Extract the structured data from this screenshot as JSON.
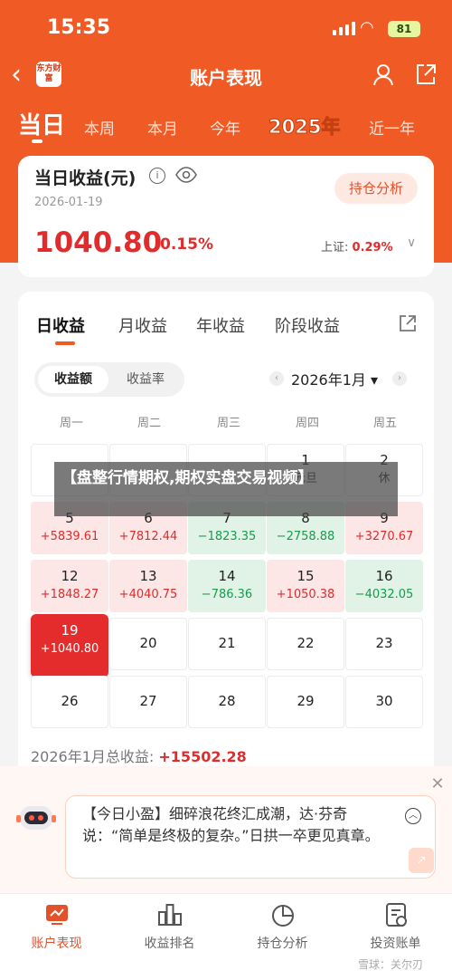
{
  "status": {
    "time": "15:35",
    "battery": "81"
  },
  "nav": {
    "logo_text": "东方财富",
    "title": "账户表现"
  },
  "periods": [
    {
      "label": "当日",
      "active": true
    },
    {
      "label": "本周"
    },
    {
      "label": "本月"
    },
    {
      "label": "今年"
    },
    {
      "label": "2025年"
    },
    {
      "label": "近一年"
    }
  ],
  "daily": {
    "title": "当日收益(元)",
    "date": "2026-01-19",
    "button": "持仓分析",
    "amount": "1040.80",
    "pct": "0.15%",
    "index_label": "上证:",
    "index_value": "0.29%"
  },
  "calendar": {
    "tabs": [
      "日收益",
      "月收益",
      "年收益",
      "阶段收益"
    ],
    "segments": [
      "收益额",
      "收益率"
    ],
    "month": "2026年1月",
    "weekdays": [
      "周一",
      "周二",
      "周三",
      "周四",
      "周五"
    ],
    "holiday_tag": "休",
    "rows": [
      [
        {
          "day": "",
          "value": ""
        },
        {
          "day": "",
          "value": ""
        },
        {
          "day": "",
          "value": ""
        },
        {
          "day": "1",
          "value": "元旦"
        },
        {
          "day": "2",
          "value": "休"
        }
      ],
      [
        {
          "day": "5",
          "value": "+5839.61",
          "trend": "up"
        },
        {
          "day": "6",
          "value": "+7812.44",
          "trend": "up"
        },
        {
          "day": "7",
          "value": "−1823.35",
          "trend": "down"
        },
        {
          "day": "8",
          "value": "−2758.88",
          "trend": "down"
        },
        {
          "day": "9",
          "value": "+3270.67",
          "trend": "up"
        }
      ],
      [
        {
          "day": "12",
          "value": "+1848.27",
          "trend": "up"
        },
        {
          "day": "13",
          "value": "+4040.75",
          "trend": "up"
        },
        {
          "day": "14",
          "value": "−786.36",
          "trend": "down"
        },
        {
          "day": "15",
          "value": "+1050.38",
          "trend": "up"
        },
        {
          "day": "16",
          "value": "−4032.05",
          "trend": "down"
        }
      ],
      [
        {
          "day": "19",
          "value": "+1040.80",
          "trend": "today"
        },
        {
          "day": "20",
          "value": ""
        },
        {
          "day": "21",
          "value": ""
        },
        {
          "day": "22",
          "value": ""
        },
        {
          "day": "23",
          "value": ""
        }
      ],
      [
        {
          "day": "26",
          "value": ""
        },
        {
          "day": "27",
          "value": ""
        },
        {
          "day": "28",
          "value": ""
        },
        {
          "day": "29",
          "value": ""
        },
        {
          "day": "30",
          "value": ""
        }
      ]
    ],
    "total_label": "2026年1月总收益:",
    "total_value": "+15502.28"
  },
  "banner": "【盘整行情期权,期权实盘交易视频】",
  "tip": {
    "text_prefix": "【今日小盈】",
    "text": "细碎浪花终汇成潮，达·芬奇说：“简单是终极的复杂。”日拱一卒更见真章。"
  },
  "bottom_nav": [
    {
      "label": "账户表现",
      "icon": "account-chart-icon",
      "active": true
    },
    {
      "label": "收益排名",
      "icon": "ranking-icon"
    },
    {
      "label": "持仓分析",
      "icon": "pie-icon"
    },
    {
      "label": "投资账单",
      "icon": "bill-icon"
    }
  ],
  "watermark": "雪球：关尔刃",
  "colors": {
    "brand": "#f05a25",
    "up": "#e02c2c",
    "down": "#1a9a4e"
  }
}
